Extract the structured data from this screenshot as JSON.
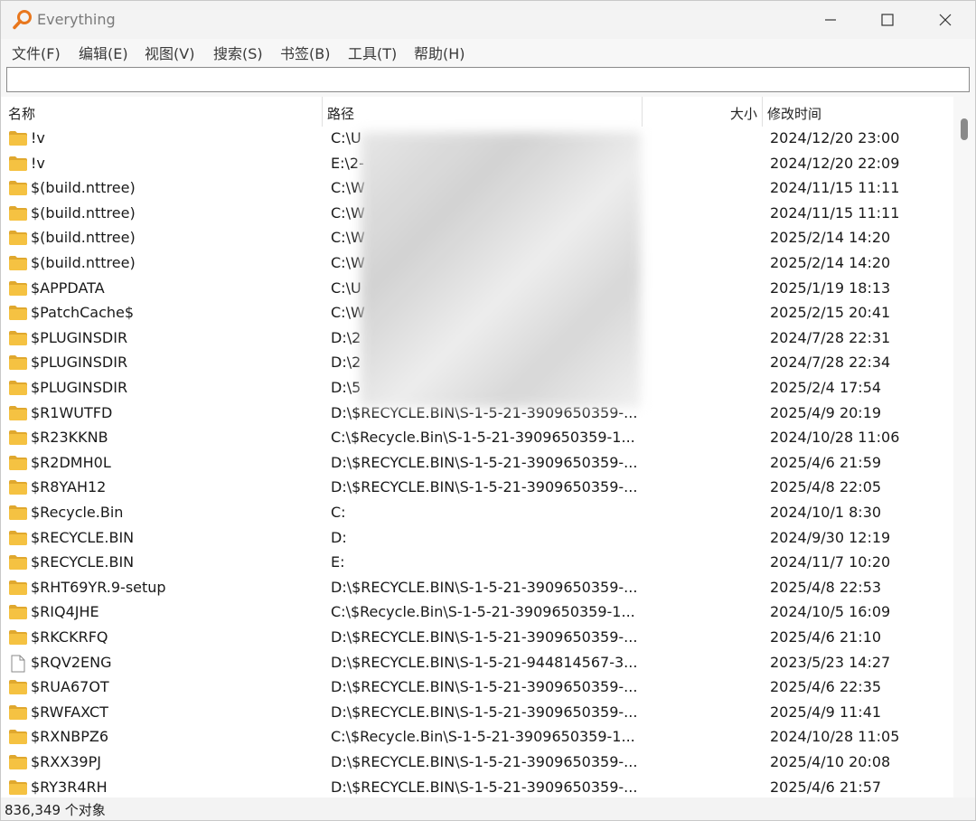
{
  "window": {
    "title": "Everything"
  },
  "menu": [
    "文件(F)",
    "编辑(E)",
    "视图(V)",
    "搜索(S)",
    "书签(B)",
    "工具(T)",
    "帮助(H)"
  ],
  "search": {
    "value": "",
    "placeholder": ""
  },
  "columns": {
    "name": "名称",
    "path": "路径",
    "size": "大小",
    "modified": "修改时间"
  },
  "rows": [
    {
      "name": "!v",
      "path": "C:\\U",
      "date": "2024/12/20 23:00",
      "icon": "folder-icon"
    },
    {
      "name": "!v",
      "path": "E:\\2-",
      "date": "2024/12/20 22:09",
      "icon": "folder-icon"
    },
    {
      "name": "$(build.nttree)",
      "path": "C:\\W",
      "date": "2024/11/15 11:11",
      "icon": "folder-icon"
    },
    {
      "name": "$(build.nttree)",
      "path": "C:\\W",
      "date": "2024/11/15 11:11",
      "icon": "folder-icon"
    },
    {
      "name": "$(build.nttree)",
      "path": "C:\\W",
      "date": "2025/2/14 14:20",
      "icon": "folder-icon"
    },
    {
      "name": "$(build.nttree)",
      "path": "C:\\W",
      "date": "2025/2/14 14:20",
      "icon": "folder-icon"
    },
    {
      "name": "$APPDATA",
      "path": "C:\\U",
      "date": "2025/1/19 18:13",
      "icon": "folder-icon"
    },
    {
      "name": "$PatchCache$",
      "path": "C:\\W",
      "date": "2025/2/15 20:41",
      "icon": "folder-icon"
    },
    {
      "name": "$PLUGINSDIR",
      "path": "D:\\2",
      "date": "2024/7/28 22:31",
      "icon": "folder-icon"
    },
    {
      "name": "$PLUGINSDIR",
      "path": "D:\\2",
      "date": "2024/7/28 22:34",
      "icon": "folder-icon"
    },
    {
      "name": "$PLUGINSDIR",
      "path": "D:\\5",
      "date": "2025/2/4 17:54",
      "icon": "folder-icon"
    },
    {
      "name": "$R1WUTFD",
      "path": "D:\\$RECYCLE.BIN\\S-1-5-21-3909650359-...",
      "date": "2025/4/9 20:19",
      "icon": "folder-icon"
    },
    {
      "name": "$R23KKNB",
      "path": "C:\\$Recycle.Bin\\S-1-5-21-3909650359-1...",
      "date": "2024/10/28 11:06",
      "icon": "folder-icon"
    },
    {
      "name": "$R2DMH0L",
      "path": "D:\\$RECYCLE.BIN\\S-1-5-21-3909650359-...",
      "date": "2025/4/6 21:59",
      "icon": "folder-icon"
    },
    {
      "name": "$R8YAH12",
      "path": "D:\\$RECYCLE.BIN\\S-1-5-21-3909650359-...",
      "date": "2025/4/8 22:05",
      "icon": "folder-icon"
    },
    {
      "name": "$Recycle.Bin",
      "path": "C:",
      "date": "2024/10/1 8:30",
      "icon": "folder-icon"
    },
    {
      "name": "$RECYCLE.BIN",
      "path": "D:",
      "date": "2024/9/30 12:19",
      "icon": "folder-icon"
    },
    {
      "name": "$RECYCLE.BIN",
      "path": "E:",
      "date": "2024/11/7 10:20",
      "icon": "folder-icon"
    },
    {
      "name": "$RHT69YR.9-setup",
      "path": "D:\\$RECYCLE.BIN\\S-1-5-21-3909650359-...",
      "date": "2025/4/8 22:53",
      "icon": "folder-icon"
    },
    {
      "name": "$RIQ4JHE",
      "path": "C:\\$Recycle.Bin\\S-1-5-21-3909650359-1...",
      "date": "2024/10/5 16:09",
      "icon": "folder-icon"
    },
    {
      "name": "$RKCKRFQ",
      "path": "D:\\$RECYCLE.BIN\\S-1-5-21-3909650359-...",
      "date": "2025/4/6 21:10",
      "icon": "folder-icon"
    },
    {
      "name": "$RQV2ENG",
      "path": "D:\\$RECYCLE.BIN\\S-1-5-21-944814567-3...",
      "date": "2023/5/23 14:27",
      "icon": "file-icon"
    },
    {
      "name": "$RUA67OT",
      "path": "D:\\$RECYCLE.BIN\\S-1-5-21-3909650359-...",
      "date": "2025/4/6 22:35",
      "icon": "folder-icon"
    },
    {
      "name": "$RWFAXCT",
      "path": "D:\\$RECYCLE.BIN\\S-1-5-21-3909650359-...",
      "date": "2025/4/9 11:41",
      "icon": "folder-icon"
    },
    {
      "name": "$RXNBPZ6",
      "path": "C:\\$Recycle.Bin\\S-1-5-21-3909650359-1...",
      "date": "2024/10/28 11:05",
      "icon": "folder-icon"
    },
    {
      "name": "$RXX39PJ",
      "path": "D:\\$RECYCLE.BIN\\S-1-5-21-3909650359-...",
      "date": "2025/4/10 20:08",
      "icon": "folder-icon"
    },
    {
      "name": "$RY3R4RH",
      "path": "D:\\$RECYCLE.BIN\\S-1-5-21-3909650359-...",
      "date": "2025/4/6 21:57",
      "icon": "folder-icon"
    }
  ],
  "status": {
    "text": "836,349 个对象"
  },
  "colors": {
    "folder": "#f5c242",
    "folder_dark": "#e0a82e",
    "app_icon": "#e8771d"
  }
}
